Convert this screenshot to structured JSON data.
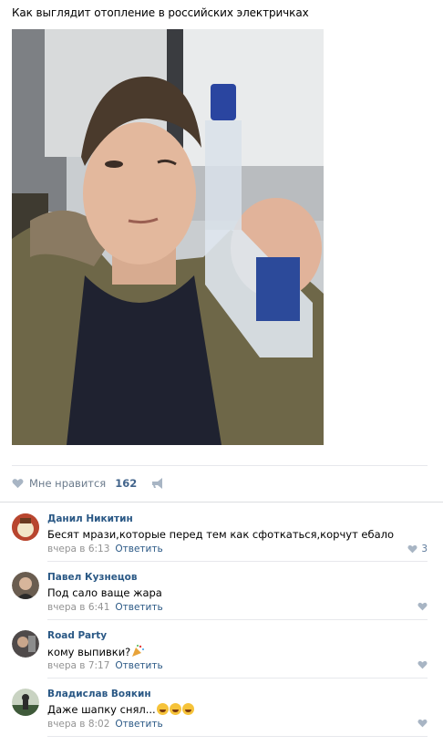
{
  "post": {
    "title": "Как выглядит отопление в российских электричках"
  },
  "likes": {
    "label": "Мне нравится",
    "count": "162"
  },
  "comments": [
    {
      "author": "Данил Никитин",
      "text": "Бесят мрази,которые перед тем как сфоткаться,корчут ебало",
      "time": "вчера в 6:13",
      "reply": "Ответить",
      "likes": "3",
      "avatar_color": "#b8452e"
    },
    {
      "author": "Павел Кузнецов",
      "text": "Под сало ваще жара",
      "time": "вчера в 6:41",
      "reply": "Ответить",
      "likes": "",
      "avatar_color": "#6a5d50"
    },
    {
      "author": "Road Party",
      "text": "кому выпивки?",
      "time": "вчера в 7:17",
      "reply": "Ответить",
      "likes": "",
      "avatar_color": "#4f4a4a"
    },
    {
      "author": "Владислав Воякин",
      "text": "Даже шапку снял...",
      "time": "вчера в 8:02",
      "reply": "Ответить",
      "likes": "",
      "avatar_color": "#3f5a3a"
    }
  ],
  "colors": {
    "link": "#2a5885",
    "meta": "#939393",
    "likes_count": "#42648b"
  }
}
